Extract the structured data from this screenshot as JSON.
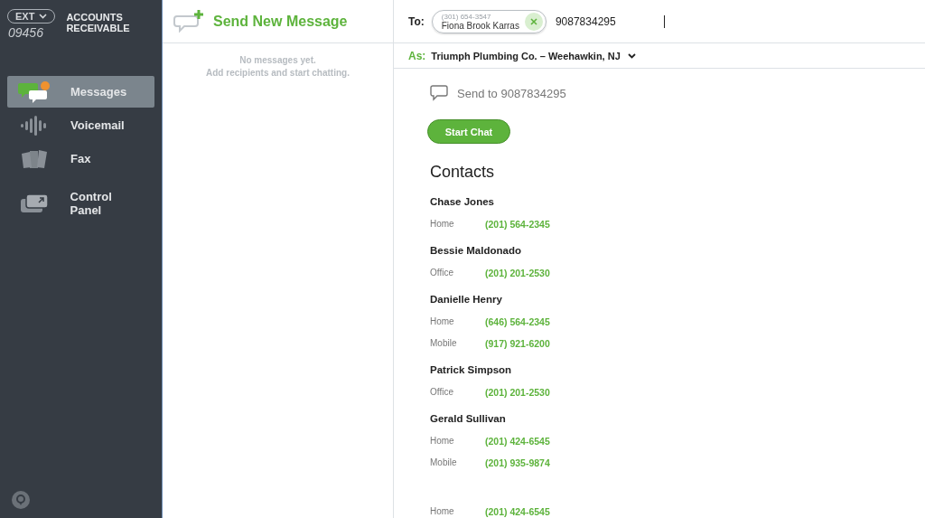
{
  "account": {
    "ext_label": "EXT",
    "extension": "09456",
    "name": "ACCOUNTS RECEIVABLE"
  },
  "nav": [
    {
      "label": "Messages",
      "kind": "messages",
      "selected": true
    },
    {
      "label": "Voicemail",
      "kind": "voicemail",
      "selected": false
    },
    {
      "label": "Fax",
      "kind": "fax",
      "selected": false
    },
    {
      "label": "Control Panel",
      "kind": "panel",
      "selected": false
    }
  ],
  "compose": {
    "title": "Send New Message",
    "empty_lines": [
      "No messages yet.",
      "Add recipients and start chatting."
    ]
  },
  "recipients": {
    "to_label": "To:",
    "chip": {
      "phone": "(301) 654-3547",
      "name": "Fiona Brook Karras"
    },
    "input_value": "9087834295"
  },
  "sender": {
    "label": "As:",
    "value": "Triumph Plumbing Co. – Weehawkin, NJ"
  },
  "send_to": "Send to 9087834295",
  "start_button": "Start Chat",
  "contacts_heading": "Contacts",
  "contacts": [
    {
      "name": "Chase Jones",
      "numbers": [
        {
          "type": "Home",
          "number": "(201) 564-2345"
        }
      ]
    },
    {
      "name": "Bessie Maldonado",
      "numbers": [
        {
          "type": "Office",
          "number": "(201) 201-2530"
        }
      ]
    },
    {
      "name": "Danielle Henry",
      "numbers": [
        {
          "type": "Home",
          "number": "(646) 564-2345"
        },
        {
          "type": "Mobile",
          "number": "(917) 921-6200"
        }
      ]
    },
    {
      "name": "Patrick Simpson",
      "numbers": [
        {
          "type": "Office",
          "number": "(201) 201-2530"
        }
      ]
    },
    {
      "name": "Gerald Sullivan",
      "numbers": [
        {
          "type": "Home",
          "number": "(201) 424-6545"
        },
        {
          "type": "Mobile",
          "number": "(201) 935-9874"
        }
      ]
    },
    {
      "numbers": [
        {
          "type": "Home",
          "number": "(201) 424-6545"
        }
      ]
    }
  ]
}
